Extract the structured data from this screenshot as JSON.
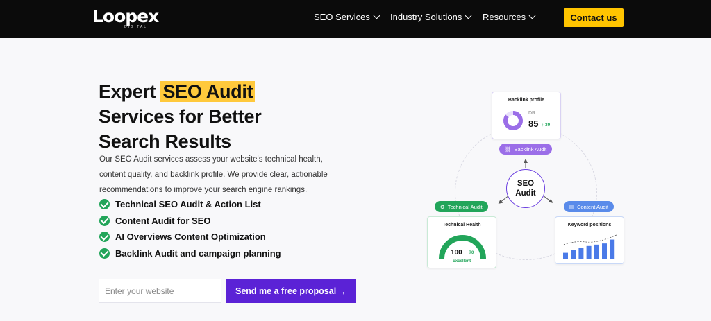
{
  "nav": {
    "logo": "Loopex",
    "logo_sub": "DIGITAL",
    "items": [
      {
        "label": "SEO Services"
      },
      {
        "label": "Industry Solutions"
      },
      {
        "label": "Resources"
      }
    ],
    "cta": "Contact us"
  },
  "hero": {
    "title_pre": "Expert ",
    "title_highlight": "SEO Audit",
    "title_line2": "Services for Better",
    "title_line3": "Search Results",
    "description": "Our SEO Audit services assess your website's technical health, content quality, and backlink profile. We provide clear, actionable recommendations to improve your search engine rankings.",
    "features": [
      "Technical SEO Audit & Action List",
      "Content Audit for SEO",
      "AI Overviews Content Optimization",
      "Backlink Audit and campaign planning"
    ],
    "input_placeholder": "Enter your website",
    "submit_label": "Send me a free proposal",
    "submit_arrow": "→"
  },
  "graphic": {
    "center_line1": "SEO",
    "center_line2": "Audit",
    "backlink": {
      "title": "Backlink profile",
      "dr_label": "DR:",
      "dr_value": "85",
      "dr_change": "↑ 30",
      "pill": "Backlink Audit",
      "donut_fraction": 0.85
    },
    "technical": {
      "title": "Technical Health",
      "score": "100",
      "change": "↑ 70",
      "status": "Excellent",
      "pill": "Technical Audit",
      "gauge_fraction": 1.0
    },
    "content": {
      "title": "Keyword positions",
      "pill": "Content Audit",
      "bars": [
        0.3,
        0.45,
        0.55,
        0.65,
        0.72,
        0.78,
        0.98
      ]
    },
    "colors": {
      "purple": "#9b6ee8",
      "green": "#22a55a",
      "blue": "#4a7ae8"
    }
  }
}
